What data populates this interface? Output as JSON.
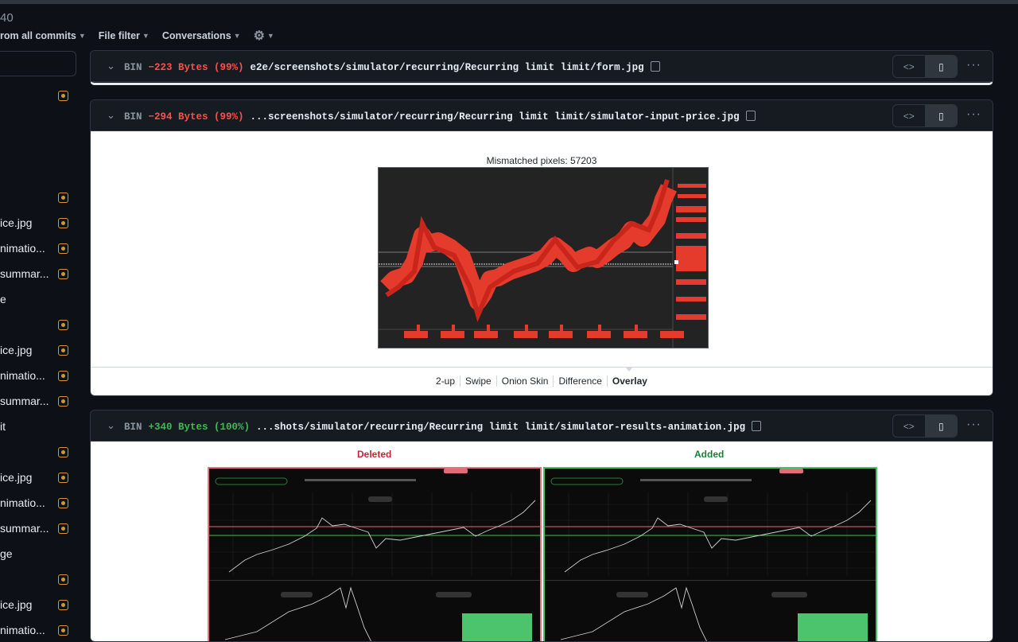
{
  "pr": {
    "number_text": "40"
  },
  "filters": {
    "commits": "rom all commits",
    "file_filter": "File filter",
    "conversations": "Conversations"
  },
  "sidebar": {
    "items": [
      {
        "name": ""
      },
      {
        "name": ""
      },
      {
        "name": "ice.jpg"
      },
      {
        "name": "nimatio..."
      },
      {
        "name": "summar..."
      },
      {
        "name": "e"
      },
      {
        "name": ""
      },
      {
        "name": "ice.jpg"
      },
      {
        "name": "nimatio..."
      },
      {
        "name": "summar..."
      },
      {
        "name": "it"
      },
      {
        "name": ""
      },
      {
        "name": "ice.jpg"
      },
      {
        "name": "nimatio..."
      },
      {
        "name": "summar..."
      },
      {
        "name": "ge"
      },
      {
        "name": ""
      },
      {
        "name": "ice.jpg"
      },
      {
        "name": "nimatio..."
      }
    ]
  },
  "files": [
    {
      "bin": "BIN",
      "delta": "−223 Bytes (99%)",
      "path": "e2e/screenshots/simulator/recurring/Recurring limit limit/form.jpg"
    },
    {
      "bin": "BIN",
      "delta": "−294 Bytes (99%)",
      "path": "...screenshots/simulator/recurring/Recurring limit limit/simulator-input-price.jpg",
      "mismatch": "Mismatched pixels: 57203",
      "views": [
        "2-up",
        "Swipe",
        "Onion Skin",
        "Difference",
        "Overlay"
      ]
    },
    {
      "bin": "BIN",
      "delta": "+340 Bytes (100%)",
      "path": "...shots/simulator/recurring/Recurring limit limit/simulator-results-animation.jpg",
      "deleted": "Deleted",
      "added": "Added"
    }
  ],
  "colors": {
    "bg": "#0d1117",
    "red": "#f85149",
    "green": "#3fb950",
    "badge": "#d29922"
  }
}
